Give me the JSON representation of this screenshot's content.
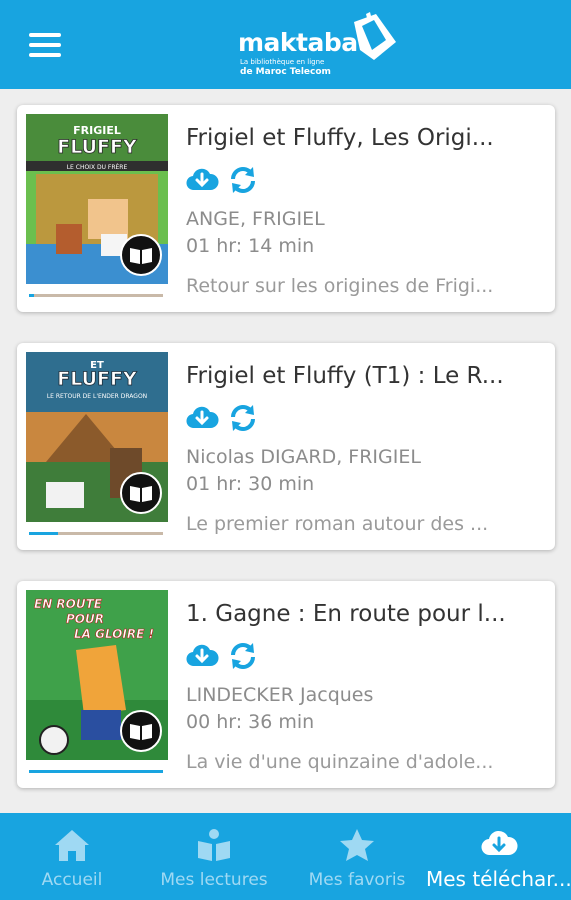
{
  "header": {
    "logo_name": "maktabati",
    "logo_tagline": "La bibliothèque en ligne",
    "logo_brand": "de Maroc Telecom",
    "brand_color": "#18a4e0"
  },
  "books": [
    {
      "title": "Frigiel et Fluffy, Les Origi...",
      "author": "ANGE, FRIGIEL",
      "duration": "01 hr: 14 min",
      "description": "Retour sur les origines de Frigi...",
      "cover_title": "FLUFFY",
      "cover_subtitle": "LE CHOIX DU FRÈRE",
      "progress_fraction": 0.04
    },
    {
      "title": "Frigiel et Fluffy (T1) : Le R...",
      "author": "Nicolas DIGARD, FRIGIEL",
      "duration": "01 hr: 30 min",
      "description": "Le premier roman autour des ...",
      "cover_top": "ET",
      "cover_title": "FLUFFY",
      "cover_subtitle": "LE RETOUR DE L'ENDER DRAGON",
      "progress_fraction": 0.22
    },
    {
      "title": "1. Gagne : En route pour l...",
      "author": "LINDECKER Jacques",
      "duration": "00 hr: 36 min",
      "description": "La vie d'une quinzaine d'adole...",
      "cover_line1": "EN ROUTE",
      "cover_line2": "POUR",
      "cover_line3": "LA GLOIRE !",
      "progress_fraction": 1.0
    }
  ],
  "icons": {
    "download": "cloud-download-icon",
    "sync": "sync-icon",
    "read": "book-icon"
  },
  "bottom_nav": [
    {
      "label": "Accueil",
      "icon": "home-icon",
      "active": false
    },
    {
      "label": "Mes lectures",
      "icon": "book-reader-icon",
      "active": false
    },
    {
      "label": "Mes favoris",
      "icon": "star-icon",
      "active": false
    },
    {
      "label": "Mes téléchar...",
      "icon": "cloud-download-icon",
      "active": true
    }
  ]
}
